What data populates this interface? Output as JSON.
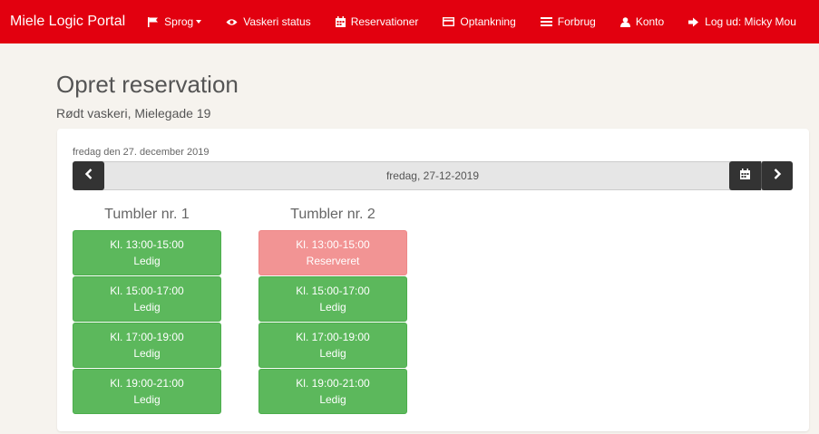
{
  "navbar": {
    "brand": "Miele Logic Portal",
    "items": [
      {
        "label": "Sprog",
        "icon": "flag-icon",
        "dropdown": true
      },
      {
        "label": "Vaskeri status",
        "icon": "eye-icon"
      },
      {
        "label": "Reservationer",
        "icon": "calendar-icon"
      },
      {
        "label": "Optankning",
        "icon": "credit-card-icon"
      },
      {
        "label": "Forbrug",
        "icon": "list-icon"
      },
      {
        "label": "Konto",
        "icon": "user-icon"
      },
      {
        "label": "Log ud: Micky Mou",
        "icon": "logout-icon"
      }
    ],
    "color": "#e2000f"
  },
  "page": {
    "title": "Opret reservation",
    "subtitle": "Rødt vaskeri, Mielegade 19"
  },
  "date": {
    "label": "fredag den 27. december 2019",
    "value": "fredag, 27-12-2019"
  },
  "machines": [
    {
      "title": "Tumbler nr. 1",
      "slots": [
        {
          "time": "Kl. 13:00-15:00",
          "status": "Ledig",
          "state": "free"
        },
        {
          "time": "Kl. 15:00-17:00",
          "status": "Ledig",
          "state": "free"
        },
        {
          "time": "Kl. 17:00-19:00",
          "status": "Ledig",
          "state": "free"
        },
        {
          "time": "Kl. 19:00-21:00",
          "status": "Ledig",
          "state": "free"
        }
      ]
    },
    {
      "title": "Tumbler nr. 2",
      "slots": [
        {
          "time": "Kl. 13:00-15:00",
          "status": "Reserveret",
          "state": "reserved"
        },
        {
          "time": "Kl. 15:00-17:00",
          "status": "Ledig",
          "state": "free"
        },
        {
          "time": "Kl. 17:00-19:00",
          "status": "Ledig",
          "state": "free"
        },
        {
          "time": "Kl. 19:00-21:00",
          "status": "Ledig",
          "state": "free"
        }
      ]
    }
  ],
  "colors": {
    "free": "#5cb85c",
    "reserved": "#f29494"
  }
}
